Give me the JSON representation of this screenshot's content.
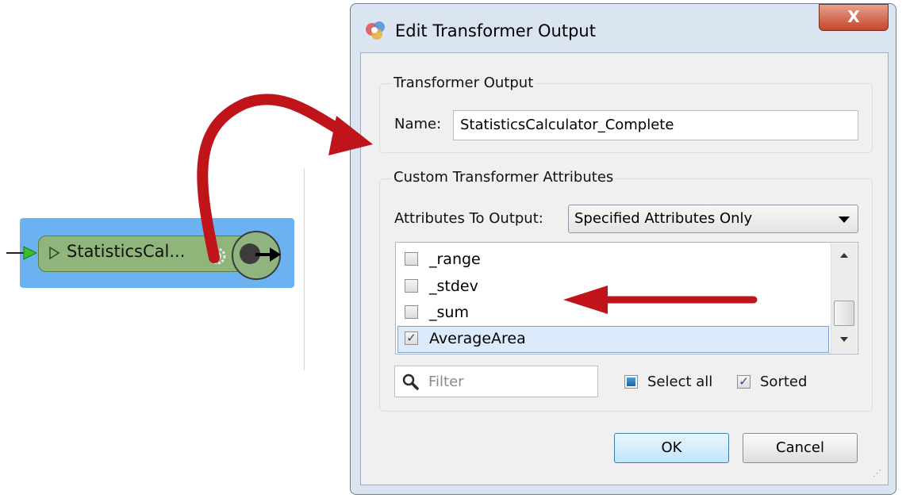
{
  "canvas": {
    "node_label": "StatisticsCal..."
  },
  "dialog": {
    "title": "Edit Transformer Output",
    "close_label": "X",
    "output_group": {
      "title": "Transformer Output",
      "name_label": "Name:",
      "name_value": "StatisticsCalculator_Complete"
    },
    "attr_group": {
      "title": "Custom Transformer Attributes",
      "output_label": "Attributes To Output:",
      "output_selected": "Specified Attributes Only",
      "items": [
        {
          "label": "_range",
          "checked": false
        },
        {
          "label": "_stdev",
          "checked": false
        },
        {
          "label": "_sum",
          "checked": false
        },
        {
          "label": "AverageArea",
          "checked": true
        }
      ],
      "filter_placeholder": "Filter",
      "select_all_label": "Select all",
      "sorted_label": "Sorted"
    },
    "ok_label": "OK",
    "cancel_label": "Cancel"
  },
  "colors": {
    "accent_red": "#c0141b",
    "selection_blue": "#6db2f0",
    "node_green": "#8fb57a"
  }
}
